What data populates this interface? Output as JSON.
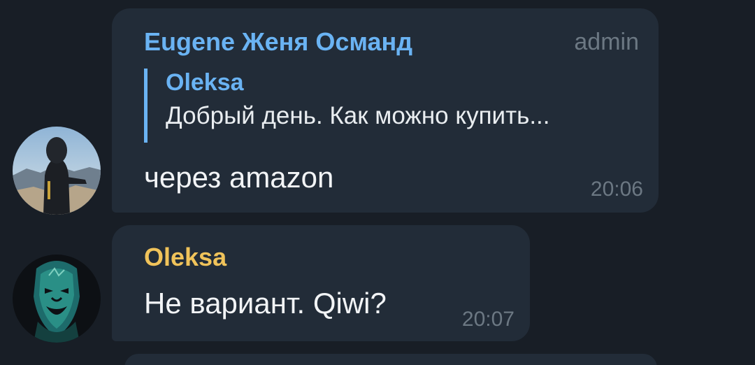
{
  "messages": [
    {
      "sender": "Eugene Женя Османд",
      "sender_color": "#6ab3f3",
      "role": "admin",
      "reply": {
        "sender": "Oleksa",
        "text": "Добрый день. Как можно купить..."
      },
      "text": "через amazon",
      "time": "20:06",
      "avatar": "hooded-person-photo"
    },
    {
      "sender": "Oleksa",
      "sender_color": "#f0c35a",
      "text": "Не вариант. Qiwi?",
      "time": "20:07",
      "avatar": "mask-portrait"
    }
  ],
  "colors": {
    "background": "#181e26",
    "bubble": "#222c38",
    "reply_bar": "#6ab3f3",
    "meta_text": "#6c7883"
  }
}
